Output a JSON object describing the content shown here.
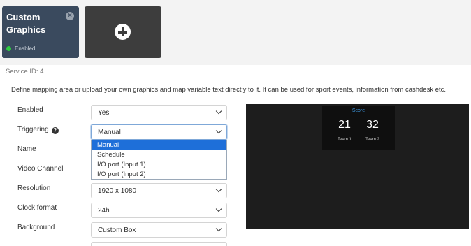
{
  "tiles": {
    "active": {
      "title": "Custom Graphics",
      "status": "Enabled",
      "close_icon": "close-circle-icon",
      "status_color": "#2ecc40"
    },
    "add": {
      "icon": "plus-circle-icon"
    }
  },
  "service_id": "Service ID: 4",
  "description": "Define mapping area or upload your own graphics and map variable text directly to it. It can be used for sport events, information from cashdesk etc.",
  "form": {
    "enabled": {
      "label": "Enabled",
      "value": "Yes"
    },
    "triggering": {
      "label": "Triggering",
      "value": "Manual",
      "help_icon": "question-circle-icon",
      "options": [
        "Manual",
        "Schedule",
        "I/O port (Input 1)",
        "I/O port (Input 2)"
      ]
    },
    "name": {
      "label": "Name"
    },
    "video_channel": {
      "label": "Video Channel"
    },
    "resolution": {
      "label": "Resolution",
      "value": "1920 x 1080"
    },
    "clock_format": {
      "label": "Clock format",
      "value": "24h"
    },
    "background": {
      "label": "Background",
      "value": "Custom Box"
    }
  },
  "preview": {
    "title": "Score",
    "team1": {
      "score": "21",
      "name": "Team 1"
    },
    "team2": {
      "score": "32",
      "name": "Team 2"
    },
    "accent": "#3c93d9"
  }
}
